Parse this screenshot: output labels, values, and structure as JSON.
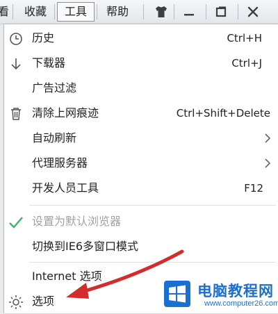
{
  "menubar": {
    "items": [
      {
        "label": "看"
      },
      {
        "label": "收藏"
      },
      {
        "label": "工具"
      },
      {
        "label": "帮助"
      }
    ],
    "icons": [
      "shirt-icon",
      "minimize-icon",
      "maximize-icon",
      "close-icon"
    ],
    "active_index": 2
  },
  "tools_menu": {
    "items": [
      {
        "icon": "history-clock-icon",
        "label": "历史",
        "shortcut": "Ctrl+H"
      },
      {
        "icon": "download-arrow-icon",
        "label": "下载器",
        "shortcut": "Ctrl+J"
      },
      {
        "label": "广告过滤"
      },
      {
        "icon": "trash-icon",
        "label": "清除上网痕迹",
        "shortcut": "Ctrl+Shift+Delete"
      },
      {
        "label": "自动刷新",
        "submenu": true
      },
      {
        "label": "代理服务器",
        "submenu": true
      },
      {
        "label": "开发人员工具",
        "shortcut": "F12"
      },
      {
        "icon": "checkmark-icon",
        "label": "设置为默认浏览器",
        "disabled": true
      },
      {
        "label": "切换到IE6多窗口模式"
      },
      {
        "label": "Internet 选项"
      },
      {
        "icon": "gear-icon",
        "label": "选项"
      }
    ]
  },
  "watermark": {
    "title": "电脑教程网",
    "url": "www.computer26.com",
    "colors": {
      "blue": "#1a6fd2",
      "red": "#e02020"
    }
  },
  "annotation": {
    "arrow_color": "#d42b2b",
    "points_to": "选项"
  }
}
